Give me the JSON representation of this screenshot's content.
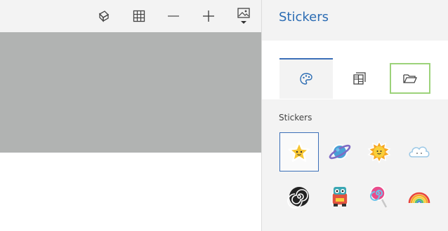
{
  "toolbar": {
    "icons": [
      "3d-shape-icon",
      "grid-icon",
      "zoom-out-icon",
      "zoom-in-icon",
      "image-dropdown-icon"
    ]
  },
  "panel": {
    "title": "Stickers",
    "tabs": [
      "stickers-tab",
      "textures-tab",
      "folder-tab"
    ],
    "section_label": "Stickers",
    "stickers": [
      "star",
      "planet",
      "sun",
      "cloud",
      "spiral",
      "monster",
      "lollipop",
      "rainbow"
    ]
  },
  "colors": {
    "accent": "#3c6fb8",
    "title": "#2b6cb3",
    "focus": "#9cd27a",
    "canvas_gray": "#b1b3b2"
  }
}
